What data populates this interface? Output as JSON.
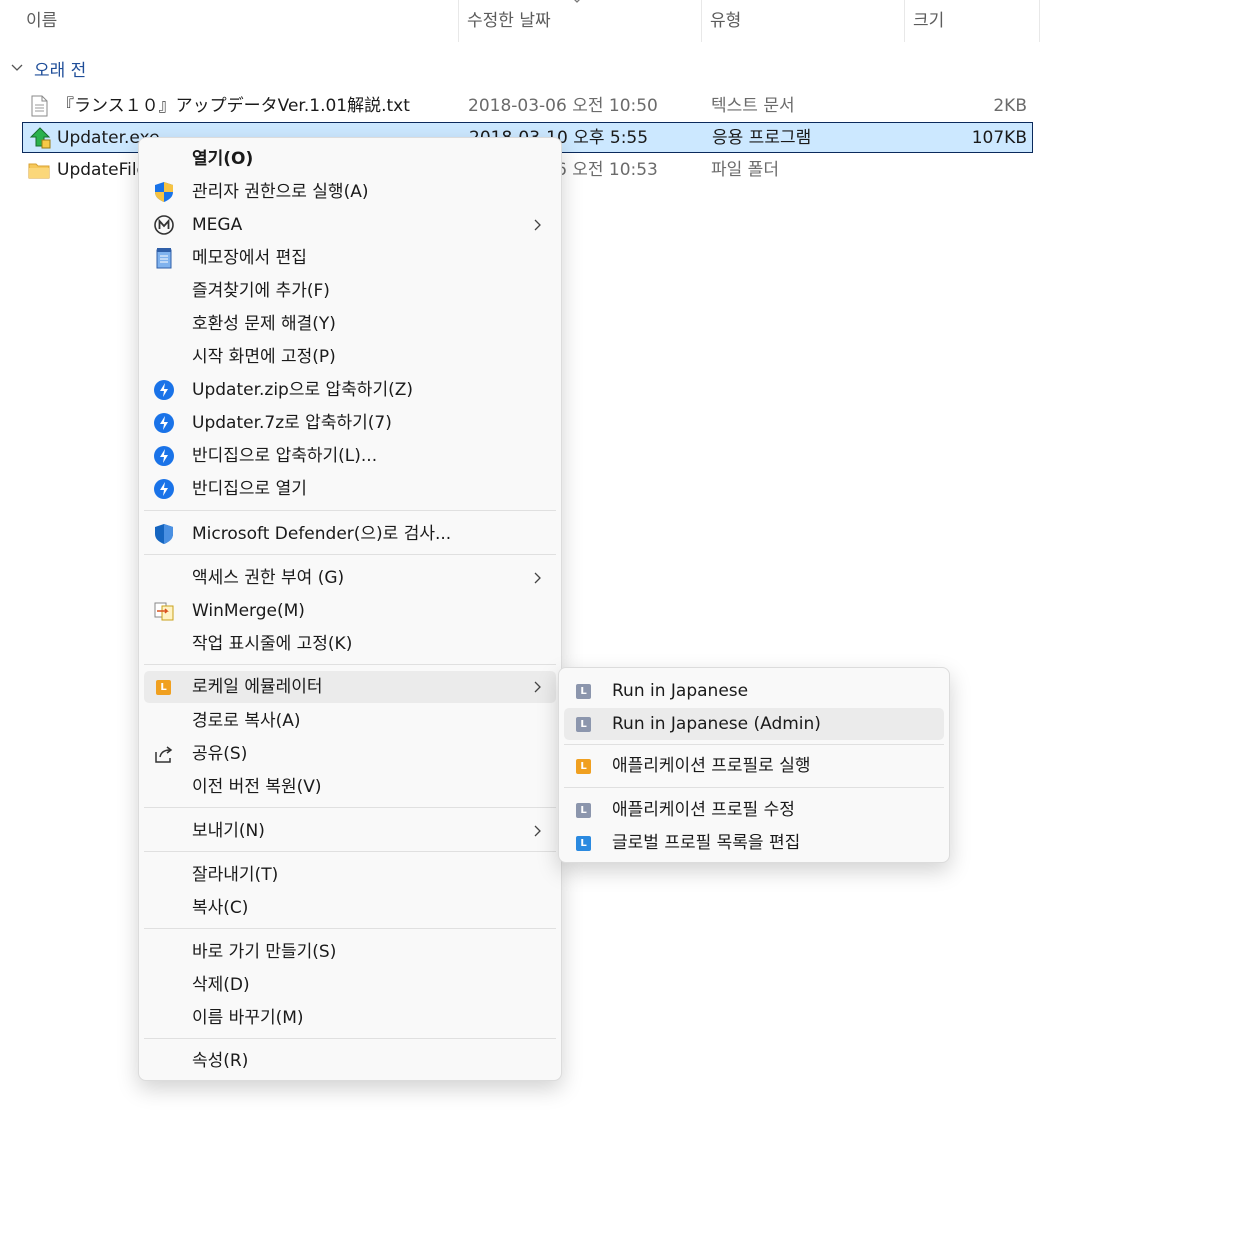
{
  "columns": {
    "name": "이름",
    "modified": "수정한 날짜",
    "type": "유형",
    "size": "크기"
  },
  "group": {
    "label": "오래 전"
  },
  "files": [
    {
      "name": "『ランス１０』アップデータVer.1.01解説.txt",
      "date": "2018-03-06 오전 10:50",
      "type": "텍스트 문서",
      "size": "2KB",
      "icon": "text-file-icon"
    },
    {
      "name": "Updater.exe",
      "date": "2018-03-10 오후 5:55",
      "type": "응용 프로그램",
      "size": "107KB",
      "icon": "updater-app-icon"
    },
    {
      "name": "UpdateFiles",
      "date": "2018-03-06 오전 10:53",
      "type": "파일 폴더",
      "size": "",
      "icon": "folder-icon"
    }
  ],
  "context_menu": {
    "open": "열기(O)",
    "run_as_admin": "관리자 권한으로 실행(A)",
    "mega": "MEGA",
    "edit_notepad": "메모장에서 편집",
    "add_favorites": "즐겨찾기에 추가(F)",
    "compat": "호환성 문제 해결(Y)",
    "pin_start": "시작 화면에 고정(P)",
    "zip": "Updater.zip으로 압축하기(Z)",
    "sevenz": "Updater.7z로 압축하기(7)",
    "bandizip_compress": "반디집으로 압축하기(L)...",
    "bandizip_open": "반디집으로 열기",
    "defender": "Microsoft Defender(으)로 검사...",
    "grant_access": "액세스 권한 부여 (G)",
    "winmerge": "WinMerge(M)",
    "pin_taskbar": "작업 표시줄에 고정(K)",
    "locale_emulator": "로케일 에뮬레이터",
    "copy_path": "경로로 복사(A)",
    "share": "공유(S)",
    "restore": "이전 버전 복원(V)",
    "send_to": "보내기(N)",
    "cut": "잘라내기(T)",
    "copy": "복사(C)",
    "shortcut": "바로 가기 만들기(S)",
    "delete": "삭제(D)",
    "rename": "이름 바꾸기(M)",
    "properties": "속성(R)"
  },
  "submenu": {
    "run_jp": "Run in Japanese",
    "run_jp_admin": "Run in Japanese (Admin)",
    "run_profile": "애플리케이션 프로필로 실행",
    "edit_profile": "애플리케이션 프로필 수정",
    "edit_global": "글로벌 프로필 목록을 편집"
  },
  "colors": {
    "selection_bg": "#cce8ff",
    "group_header": "#1f4e99",
    "bandizip_blue": "#1a73e8",
    "locale_orange": "#f0a020"
  }
}
